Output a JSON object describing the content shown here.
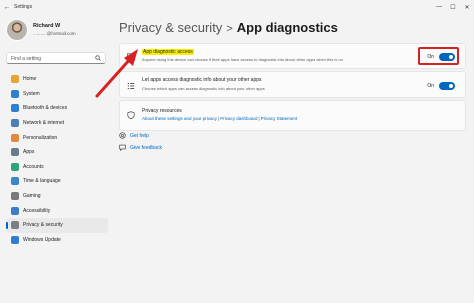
{
  "window": {
    "title": "Settings",
    "back_glyph": "←",
    "controls": {
      "minimize": "—",
      "maximize": "☐",
      "close": "✕"
    }
  },
  "profile": {
    "name": "Richard W",
    "email": "...........@hotmail.com"
  },
  "search": {
    "placeholder": "Find a setting"
  },
  "sidebar": {
    "items": [
      {
        "label": "Home",
        "icon": "home-icon",
        "color": "#e6a434"
      },
      {
        "label": "System",
        "icon": "system-icon",
        "color": "#2f7fd1"
      },
      {
        "label": "Bluetooth & devices",
        "icon": "bluetooth-icon",
        "color": "#2f7fd1"
      },
      {
        "label": "Network & internet",
        "icon": "network-icon",
        "color": "#4a7fb5"
      },
      {
        "label": "Personalization",
        "icon": "brush-icon",
        "color": "#e08a3c"
      },
      {
        "label": "Apps",
        "icon": "apps-icon",
        "color": "#6b7b8c"
      },
      {
        "label": "Accounts",
        "icon": "accounts-icon",
        "color": "#2fa57a"
      },
      {
        "label": "Time & language",
        "icon": "globe-icon",
        "color": "#3a86c8"
      },
      {
        "label": "Gaming",
        "icon": "gaming-icon",
        "color": "#7a7a7a"
      },
      {
        "label": "Accessibility",
        "icon": "accessibility-icon",
        "color": "#3d7ec9"
      },
      {
        "label": "Privacy & security",
        "icon": "shield-icon",
        "color": "#7a7f87",
        "selected": true
      },
      {
        "label": "Windows Update",
        "icon": "update-icon",
        "color": "#2f7fd1"
      }
    ]
  },
  "breadcrumb": {
    "parent": "Privacy & security",
    "separator": ">",
    "current": "App diagnostics"
  },
  "settings": {
    "app_diagnostic_access": {
      "title": "App diagnostic access",
      "description": "Anyone using this device can choose if their apps have access to diagnostic info about other apps when this is on",
      "state": "On",
      "enabled": true
    },
    "let_apps_access": {
      "title": "Let apps access diagnostic info about your other apps",
      "description": "Choose which apps can access diagnostic info about your other apps",
      "state": "On",
      "enabled": true
    },
    "privacy_resources": {
      "title": "Privacy resources",
      "links": [
        "About these settings and your privacy",
        "Privacy dashboard",
        "Privacy Statement"
      ],
      "separator": "|"
    }
  },
  "help_links": {
    "get_help": "Get help",
    "give_feedback": "Give feedback"
  },
  "colors": {
    "accent": "#0067c0",
    "annotation_red": "#d62222",
    "highlight_yellow": "#f7f000"
  }
}
